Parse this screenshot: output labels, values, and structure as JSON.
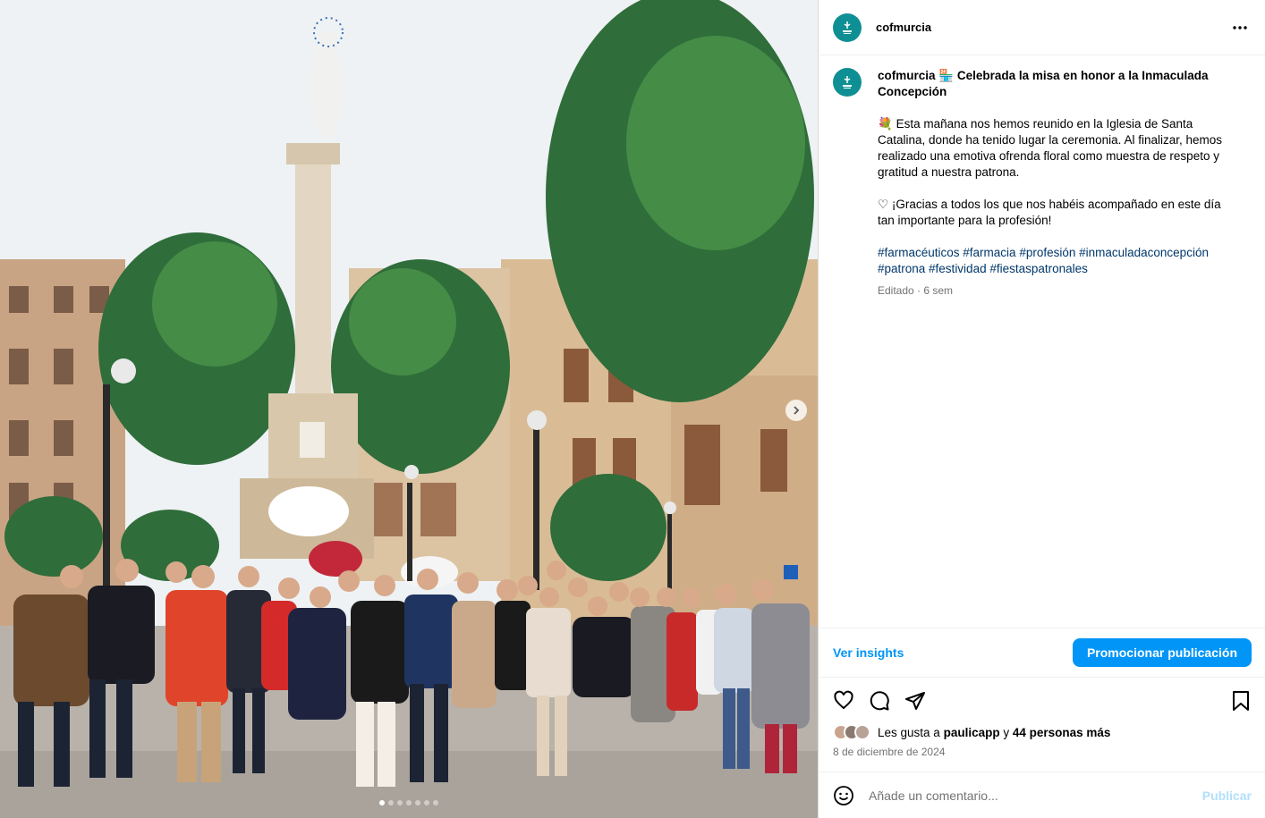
{
  "post": {
    "username": "cofmurcia",
    "avatar_icon": "cofm-logo-icon",
    "more_icon": "more-options-icon"
  },
  "caption": {
    "username": "cofmurcia",
    "title_emoji": "🏪",
    "title": "Celebrada la misa en honor a la Inmaculada Concepción",
    "para1_emoji": "💐",
    "para1": "Esta mañana nos hemos reunido en la Iglesia de Santa Catalina, donde ha tenido lugar la ceremonia. Al finalizar, hemos realizado una emotiva ofrenda floral como muestra de respeto y gratitud a nuestra patrona.",
    "para2_emoji": "♡",
    "para2": "¡Gracias a todos los que nos habéis acompañado en este día tan importante para la profesión!",
    "hashtags": "#farmacéuticos #farmacia #profesión #inmaculadaconcepción #patrona #festividad #fiestaspatronales",
    "meta": "Editado · 6 sem"
  },
  "insights": {
    "link": "Ver insights",
    "promote": "Promocionar publicación"
  },
  "actions": {
    "icons": [
      "heart-icon",
      "comment-icon",
      "share-icon",
      "bookmark-icon"
    ],
    "likes_prefix": "Les gusta a ",
    "likes_user": "paulicapp",
    "likes_mid": " y ",
    "likes_rest": "44 personas más",
    "date": "8 de diciembre de 2024"
  },
  "comment": {
    "placeholder": "Añade un comentario...",
    "submit": "Publicar"
  },
  "carousel": {
    "slide_count": 7,
    "active_slide": 1
  },
  "colors": {
    "accent": "#0095f6",
    "brand": "#0e8f93",
    "hashtag": "#00376b"
  }
}
